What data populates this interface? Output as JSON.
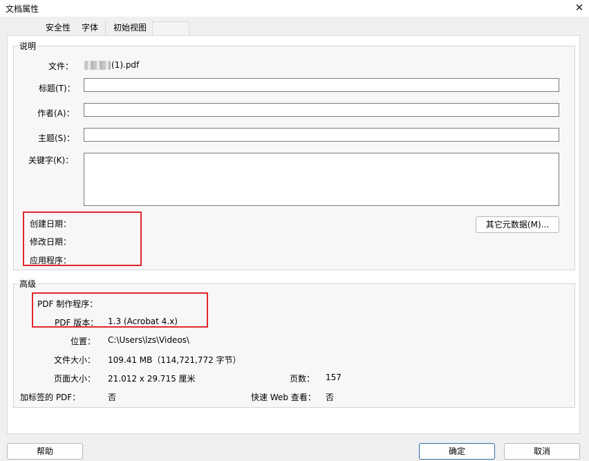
{
  "window": {
    "title": "文档属性",
    "close_glyph": "✕"
  },
  "tabs": [
    {
      "label": "安全性"
    },
    {
      "label": "字体"
    },
    {
      "label": "初始视图"
    }
  ],
  "description": {
    "legend": "说明",
    "file_label": "文件：",
    "file_value": "(1).pdf",
    "title_label": "标题(T)：",
    "title_value": "",
    "author_label": "作者(A)：",
    "author_value": "",
    "subject_label": "主题(S)：",
    "subject_value": "",
    "keywords_label": "关键字(K)：",
    "keywords_value": "",
    "created_label": "创建日期：",
    "modified_label": "修改日期：",
    "application_label": "应用程序：",
    "metadata_button": "其它元数据(M)..."
  },
  "advanced": {
    "legend": "高级",
    "producer_label": "PDF 制作程序：",
    "producer_value": "",
    "version_label": "PDF 版本：",
    "version_value": "1.3 (Acrobat 4.x)",
    "location_label": "位置：",
    "location_value": "C:\\Users\\lzs\\Videos\\",
    "filesize_label": "文件大小：",
    "filesize_value": "109.41 MB（114,721,772 字节）",
    "pagesize_label": "页面大小：",
    "pagesize_value": "21.012 x 29.715 厘米",
    "pages_label": "页数：",
    "pages_value": "157",
    "tagged_label": "加标签的 PDF：",
    "tagged_value": "否",
    "fastweb_label": "快速 Web 查看：",
    "fastweb_value": "否"
  },
  "footer": {
    "help_button": "帮助",
    "ok_button": "确定",
    "cancel_button": "取消"
  },
  "colors": {
    "highlight_box": "#e0262b",
    "primary_border": "#2f6ea7"
  }
}
